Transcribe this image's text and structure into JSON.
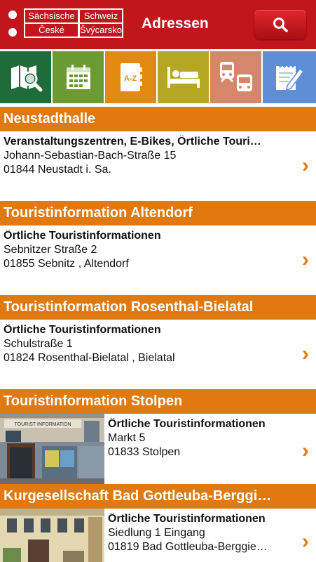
{
  "header": {
    "logo": {
      "top_left": "Sächsische",
      "top_right": "Schweiz",
      "bottom_left": "České",
      "bottom_right": "Švýcarsko"
    },
    "title": "Adressen",
    "search_icon": "search-icon"
  },
  "tabs": [
    {
      "icon": "map-search-icon",
      "color": "#1f6b3a"
    },
    {
      "icon": "calendar-icon",
      "color": "#6a9a31"
    },
    {
      "icon": "address-book-icon",
      "color": "#e08a12"
    },
    {
      "icon": "bed-icon",
      "color": "#b5a722"
    },
    {
      "icon": "train-bus-icon",
      "color": "#d4876a"
    },
    {
      "icon": "notepad-pen-icon",
      "color": "#5e8fd6"
    }
  ],
  "entries": [
    {
      "title": "Neustadthalle",
      "category": "Veranstaltungszentren, E-Bikes, Örtliche Touri…",
      "street": "Johann-Sebastian-Bach-Straße 15",
      "city": "01844 Neustadt i. Sa."
    },
    {
      "title": "Touristinformation Altendorf",
      "category": "Örtliche Touristinformationen",
      "street": "Sebnitzer Straße 2",
      "city": "01855 Sebnitz , Altendorf"
    },
    {
      "title": "Touristinformation Rosenthal-Bielatal",
      "category": "Örtliche Touristinformationen",
      "street": "Schulstraße 1",
      "city": "01824 Rosenthal-Bielatal , Bielatal"
    },
    {
      "title": "Touristinformation Stolpen",
      "category": "Örtliche Touristinformationen",
      "street": "Markt 5",
      "city": "01833 Stolpen",
      "image_sign": "TOURIST-INFORMATION"
    },
    {
      "title": "Kurgesellschaft Bad Gottleuba-Berggi…",
      "category": "Örtliche Touristinformationen",
      "street": "Siedlung 1 Eingang",
      "city": "01819 Bad Gottleuba-Berggie…"
    }
  ]
}
